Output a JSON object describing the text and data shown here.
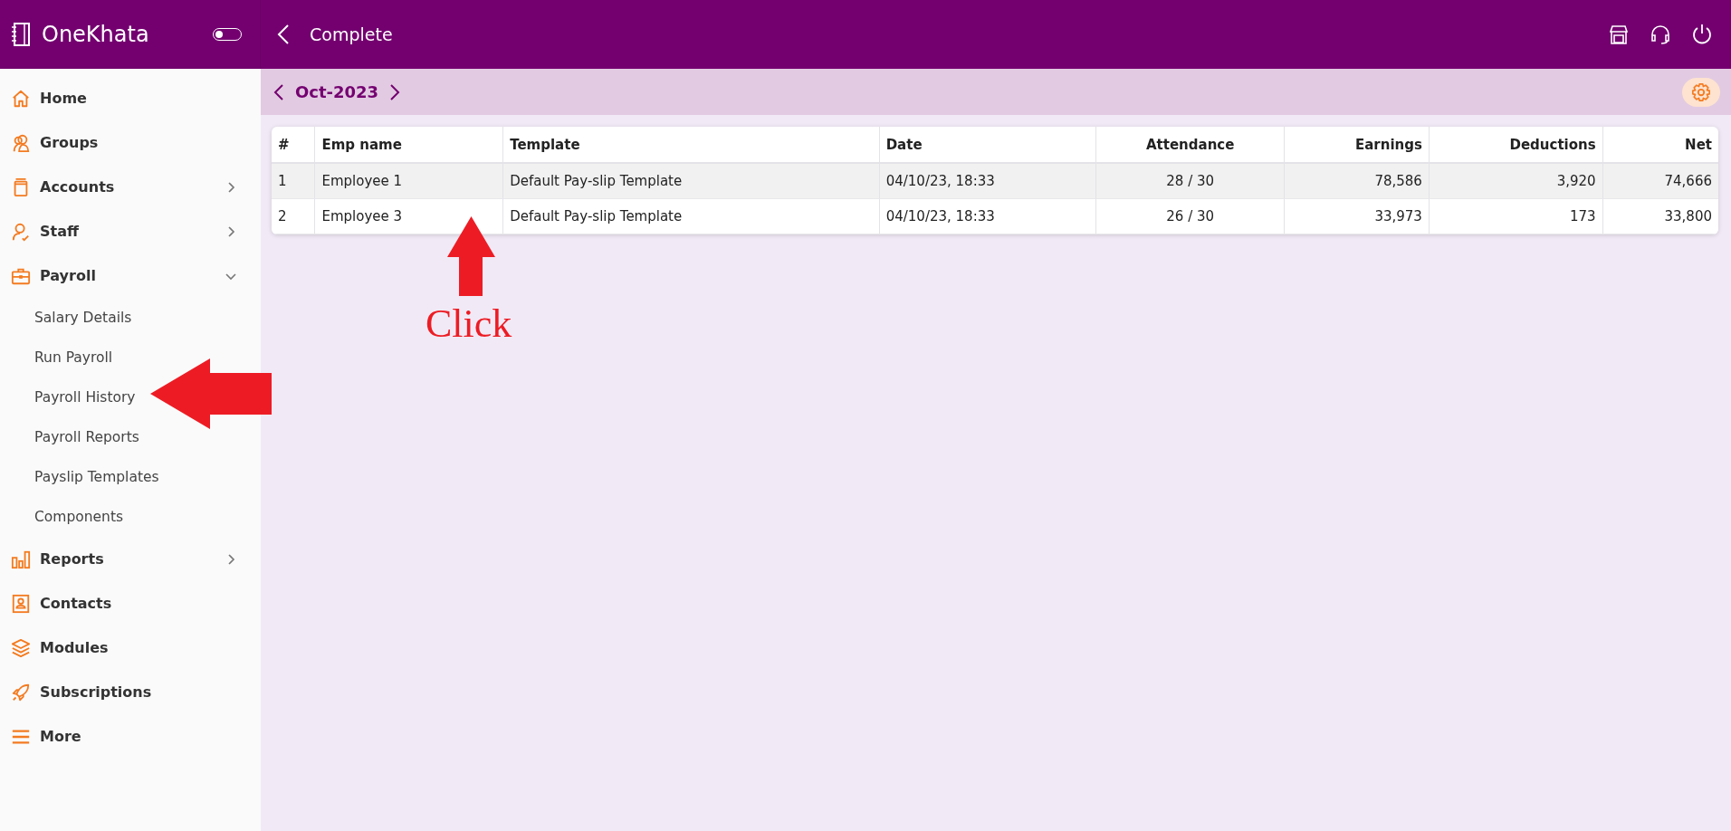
{
  "app": {
    "name": "OneKhata",
    "toggle": {
      "on": false
    }
  },
  "header": {
    "title": "Complete"
  },
  "sidebar": {
    "items": [
      {
        "kind": "link",
        "label": "Home"
      },
      {
        "kind": "link",
        "label": "Groups"
      },
      {
        "kind": "menu",
        "label": "Accounts",
        "expanded": false
      },
      {
        "kind": "menu",
        "label": "Staff",
        "expanded": false
      },
      {
        "kind": "menu",
        "label": "Payroll",
        "expanded": true,
        "children": [
          {
            "label": "Salary Details"
          },
          {
            "label": "Run Payroll"
          },
          {
            "label": "Payroll History"
          },
          {
            "label": "Payroll Reports"
          },
          {
            "label": "Payslip Templates"
          },
          {
            "label": "Components"
          }
        ]
      },
      {
        "kind": "menu",
        "label": "Reports",
        "expanded": false
      },
      {
        "kind": "link",
        "label": "Contacts"
      },
      {
        "kind": "link",
        "label": "Modules"
      },
      {
        "kind": "link",
        "label": "Subscriptions"
      },
      {
        "kind": "link",
        "label": "More"
      }
    ]
  },
  "period": {
    "label": "Oct-2023"
  },
  "table": {
    "columns": [
      {
        "label": "#",
        "kind": "index"
      },
      {
        "label": "Emp name",
        "kind": "text"
      },
      {
        "label": "Template",
        "kind": "text"
      },
      {
        "label": "Date",
        "kind": "date"
      },
      {
        "label": "Attendance",
        "kind": "ratio"
      },
      {
        "label": "Earnings",
        "kind": "amount"
      },
      {
        "label": "Deductions",
        "kind": "amount"
      },
      {
        "label": "Net",
        "kind": "amount"
      }
    ],
    "rows": [
      {
        "selected": true,
        "cells": [
          "1",
          "Employee 1",
          "Default Pay-slip Template",
          "04/10/23, 18:33",
          "28 / 30",
          "78,586",
          "3,920",
          "74,666"
        ]
      },
      {
        "selected": false,
        "cells": [
          "2",
          "Employee 3",
          "Default Pay-slip Template",
          "04/10/23, 18:33",
          "26 / 30",
          "33,973",
          "173",
          "33,800"
        ]
      }
    ]
  },
  "annotations": [
    {
      "kind": "arrow-left"
    },
    {
      "kind": "arrow-up"
    },
    {
      "kind": "note",
      "text": "Click"
    }
  ]
}
